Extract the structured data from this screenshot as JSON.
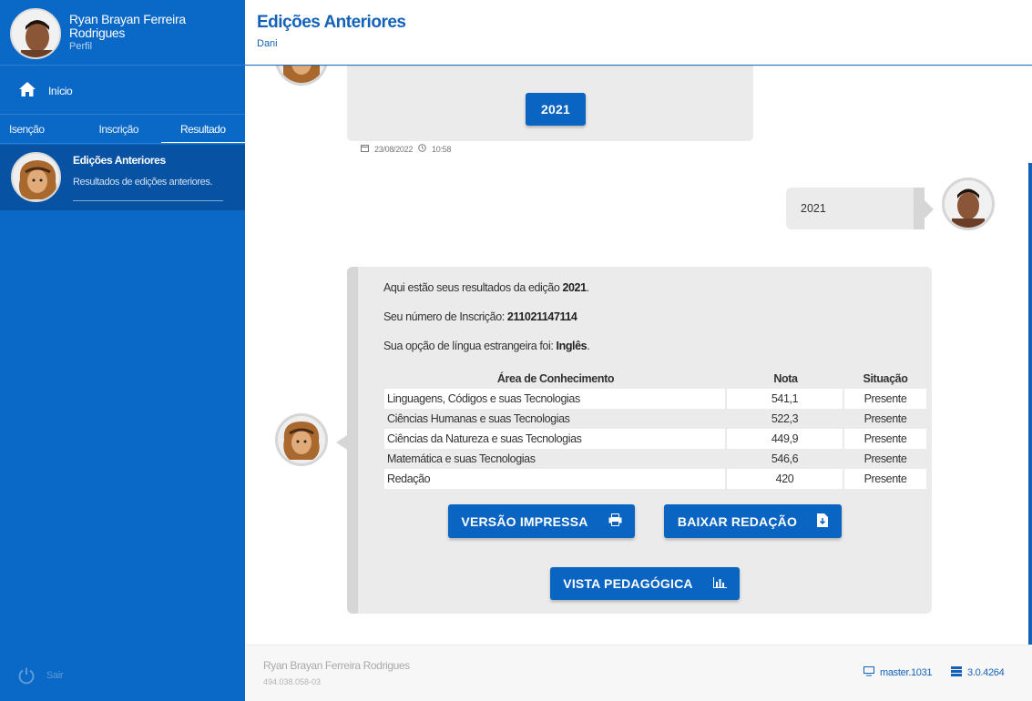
{
  "user": {
    "name": "Ryan Brayan Ferreira Rodrigues",
    "profile_link": "Perfil",
    "cpf": "494.038.058-03"
  },
  "sidebar": {
    "home_label": "Início",
    "tabs": [
      {
        "label": "Isenção",
        "active": false
      },
      {
        "label": "Inscrição",
        "active": false
      },
      {
        "label": "Resultado",
        "active": true
      }
    ],
    "active_item": {
      "title": "Edições Anteriores",
      "description": "Resultados de edições anteriores."
    },
    "logout_label": "Sair"
  },
  "header": {
    "title": "Edições Anteriores",
    "subtitle": "Dani"
  },
  "chat": {
    "first_bubble": {
      "button_label": "2021",
      "date": "23/08/2022",
      "time": "10:58"
    },
    "user_reply": "2021",
    "result": {
      "line1_prefix": "Aqui estão seus resultados da edição ",
      "line1_value": "2021",
      "line1_suffix": ".",
      "line2_prefix": "Seu número de Inscrição: ",
      "line2_value": "211021147114",
      "line3_prefix": "Sua opção de língua estrangeira foi: ",
      "line3_value": "Inglês",
      "line3_suffix": ".",
      "table": {
        "headers": [
          "Área de Conhecimento",
          "Nota",
          "Situação"
        ],
        "rows": [
          {
            "area": "Linguagens, Códigos e suas Tecnologias",
            "nota": "541,1",
            "situacao": "Presente"
          },
          {
            "area": "Ciências Humanas e suas Tecnologias",
            "nota": "522,3",
            "situacao": "Presente"
          },
          {
            "area": "Ciências da Natureza e suas Tecnologias",
            "nota": "449,9",
            "situacao": "Presente"
          },
          {
            "area": "Matemática e suas Tecnologias",
            "nota": "546,6",
            "situacao": "Presente"
          },
          {
            "area": "Redação",
            "nota": "420",
            "situacao": "Presente"
          }
        ]
      },
      "buttons": {
        "print": "VERSÃO IMPRESSA",
        "download": "BAIXAR REDAÇÃO",
        "pedagogic": "VISTA PEDAGÓGICA"
      }
    }
  },
  "footer": {
    "branch": "master.1031",
    "version": "3.0.4264"
  },
  "colors": {
    "sidebar": "#0a69c7",
    "sidebar_active": "#0752a3",
    "accent": "#1462b8",
    "button": "#0a64c2",
    "bubble": "#ebebeb"
  }
}
